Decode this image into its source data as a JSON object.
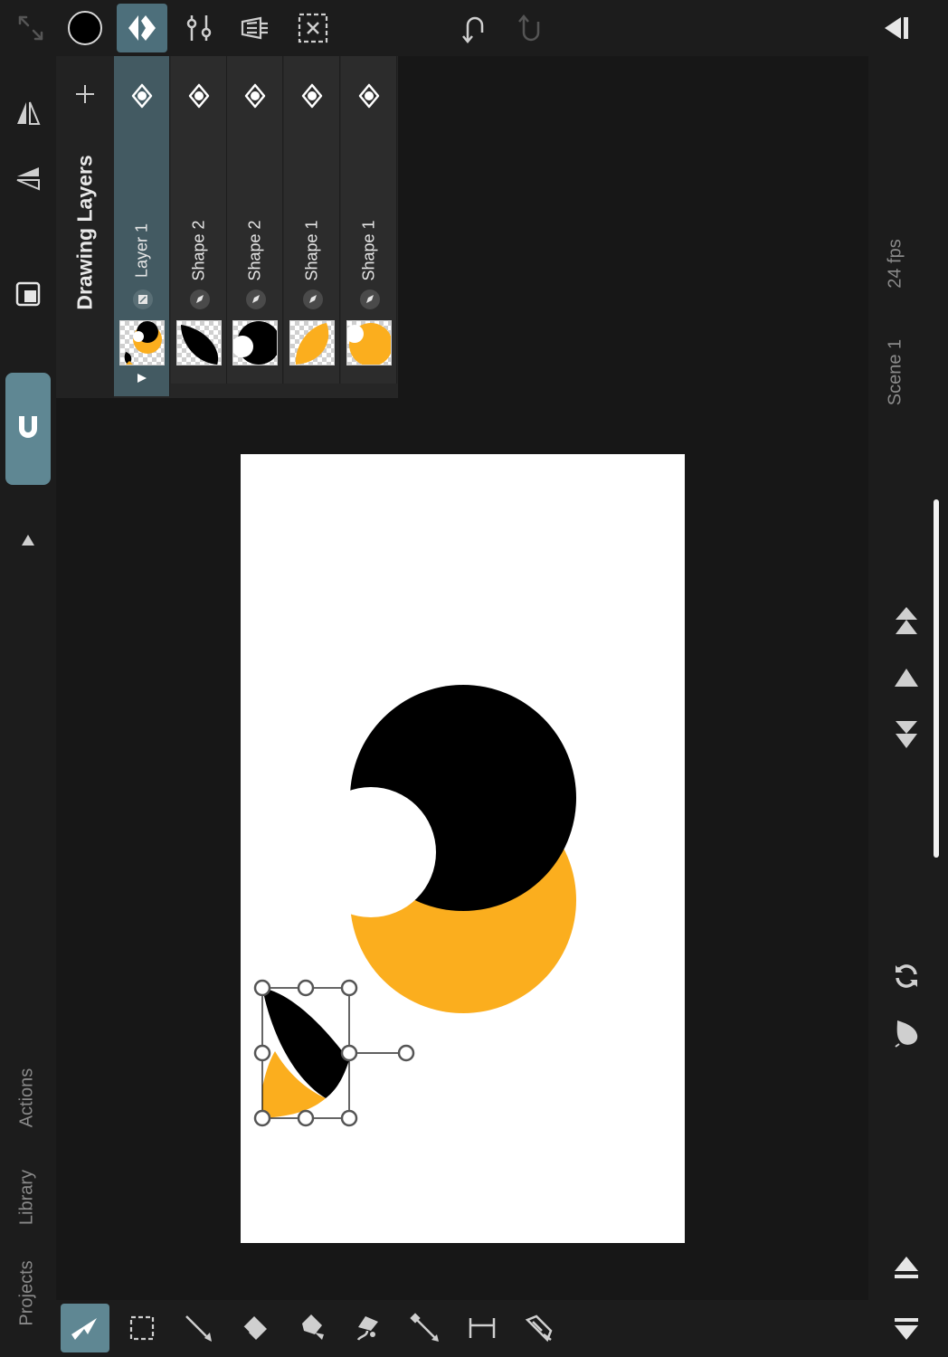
{
  "colors": {
    "accent": "#5f8793",
    "selected_layer": "#435a62",
    "shape_black": "#000000",
    "shape_orange": "#fbae1e",
    "canvas": "#ffffff"
  },
  "layers_panel": {
    "title": "Drawing Layers",
    "add_icon": "plus-icon",
    "layers": [
      {
        "name": "Layer 1",
        "selected": true,
        "badge_icon": "group-icon"
      },
      {
        "name": "Shape 2",
        "selected": false,
        "badge_icon": "pen-icon"
      },
      {
        "name": "Shape 2",
        "selected": false,
        "badge_icon": "pen-icon"
      },
      {
        "name": "Shape 1",
        "selected": false,
        "badge_icon": "pen-icon"
      },
      {
        "name": "Shape 1",
        "selected": false,
        "badge_icon": "pen-icon"
      }
    ]
  },
  "left_sidebar": {
    "tabs": [
      "Actions",
      "Library",
      "Projects"
    ]
  },
  "right_sidebar": {
    "scene": "Scene 1",
    "fps": "24 fps"
  },
  "toolbar_top": {
    "icons": [
      "collapse-arrows-icon",
      "color-swatch",
      "layers-icon",
      "adjustments-icon",
      "timeline-icon",
      "deselect-icon",
      "undo-icon",
      "redo-icon",
      "collapse-panel-icon"
    ]
  },
  "toolbar_bottom": {
    "tools": [
      "select-arrow-icon",
      "marquee-select-icon",
      "line-tool-icon",
      "eraser-icon",
      "fill-icon",
      "lasso-icon",
      "eyedropper-icon",
      "measure-icon",
      "pen-tool-icon"
    ],
    "active_tool": "select-arrow-icon"
  }
}
